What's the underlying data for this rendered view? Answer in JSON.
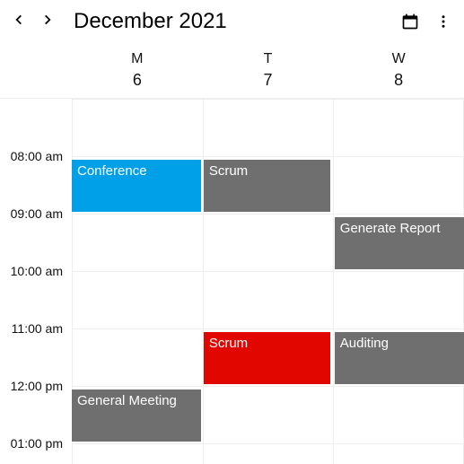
{
  "header": {
    "title": "December 2021"
  },
  "days": [
    {
      "dow": "M",
      "dom": "6"
    },
    {
      "dow": "T",
      "dom": "7"
    },
    {
      "dow": "W",
      "dom": "8"
    }
  ],
  "times": {
    "t0800": "08:00 am",
    "t0900": "09:00 am",
    "t1000": "10:00 am",
    "t1100": "11:00 am",
    "t1200": "12:00 pm",
    "t0100": "01:00 pm"
  },
  "events": {
    "conference": {
      "label": "Conference"
    },
    "scrum_morning": {
      "label": "Scrum"
    },
    "generate_report": {
      "label": "Generate Report"
    },
    "scrum_noon": {
      "label": "Scrum"
    },
    "auditing": {
      "label": "Auditing"
    },
    "general_meeting": {
      "label": "General Meeting"
    }
  },
  "colors": {
    "blue": "#00a0e9",
    "gray": "#6f6f6f",
    "red": "#e10600"
  }
}
